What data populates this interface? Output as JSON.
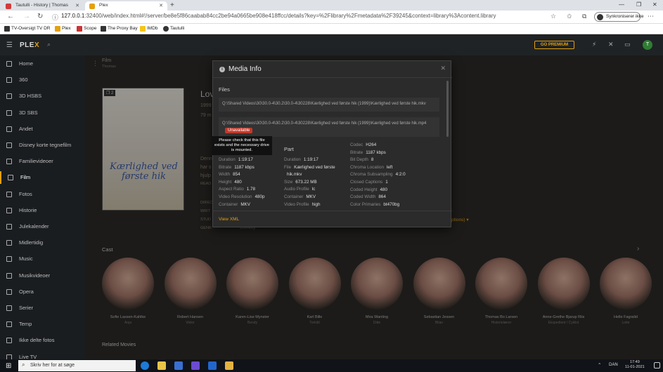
{
  "browser": {
    "tabs": [
      {
        "title": "Tautulli - History | Thomas"
      },
      {
        "title": "Plex"
      }
    ],
    "new_tab": "+",
    "url_host": "127.0.0.1",
    "url_path": ":32400/web/index.html#!/server/be8e5f86caabab84cc2be94a0665be908e418ffcc/details?key=%2Flibrary%2Fmetadata%2F39245&context=library%3Acontent.library",
    "sync_label": "Synkroniserer ikke",
    "bookmarks": [
      "TV-Oversigt TV DR",
      "Plex",
      "Scope",
      "The Proxy Bay",
      "IMDb",
      "Tautulli"
    ]
  },
  "plex": {
    "logo_main": "PLE",
    "logo_accent": "X",
    "go_premium": "GO PREMIUM",
    "user_initial": "T"
  },
  "sidebar": {
    "items": [
      {
        "label": "Home",
        "active": false
      },
      {
        "label": "360",
        "active": false
      },
      {
        "label": "3D HSBS",
        "active": false
      },
      {
        "label": "3D SBS",
        "active": false
      },
      {
        "label": "Andet",
        "active": false
      },
      {
        "label": "Disney korte tegnefilm",
        "active": false
      },
      {
        "label": "Familievideoer",
        "active": false
      },
      {
        "label": "Film",
        "active": true
      },
      {
        "label": "Fotos",
        "active": false
      },
      {
        "label": "Historie",
        "active": false
      },
      {
        "label": "Julekalender",
        "active": false
      },
      {
        "label": "Midlertidig",
        "active": false
      },
      {
        "label": "Music",
        "active": false
      },
      {
        "label": "Musikvideoer",
        "active": false
      },
      {
        "label": "Opera",
        "active": false
      },
      {
        "label": "Serier",
        "active": false
      },
      {
        "label": "Temp",
        "active": false
      },
      {
        "label": "Ikke delte fotos",
        "active": false
      },
      {
        "label": "Live TV",
        "active": false
      }
    ]
  },
  "main": {
    "breadcrumb": "Film",
    "breadcrumb_sub": "Thomas",
    "poster_badge": "2",
    "poster_title": "Kærlighed ved første hik",
    "bg_title": "Lov",
    "bg_year": "1999",
    "bg_duration": "79 m",
    "bg_line1": "Denn",
    "bg_line2": "har s",
    "bg_line3": "hjulp",
    "bg_read": "READ",
    "bg_dire": "DIREC",
    "bg_writ": "WRIT",
    "bg_stud": "STUD",
    "bg_genr": "GENR",
    "bg_comedy": "Comedy",
    "bg_captions": "ptions) ▾",
    "cast_heading": "Cast",
    "related_heading": "Related Movies",
    "cast": [
      {
        "name": "Sofie Lassen-Kahlke",
        "role": "Anja"
      },
      {
        "name": "Robert Hansen",
        "role": "Viktor"
      },
      {
        "name": "Karen-Lise Mynster",
        "role": "Bendy"
      },
      {
        "name": "Karl Bille",
        "role": "Torkild"
      },
      {
        "name": "Mira Wanting",
        "role": "Ditte"
      },
      {
        "name": "Sebastian Jessen",
        "role": "Bilan"
      },
      {
        "name": "Thomas Bo Larsen",
        "role": "Historielærer"
      },
      {
        "name": "Anne-Grethe Bjarup Riis",
        "role": "Ekspedient / Cyklist"
      },
      {
        "name": "Helle Fagralid",
        "role": "Lotte"
      }
    ]
  },
  "modal": {
    "title": "Media Info",
    "files_heading": "Files",
    "file1": "Q:\\Shared Videos\\30\\30.0-4\\30.2\\30.0-4\\30228\\Kærlighed ved første hik (1999)\\Kærlighed ved første hik.mkv",
    "file2": "Q:\\Shared Videos\\30\\30.0-4\\30.2\\30.0-4\\30228\\Kærlighed ved første hik (1999)\\Kærlighed ved første hik.mp4",
    "unavailable": "Unavailable",
    "tooltip": "Please check that this file exists and the necessary drive is mounted.",
    "media_col": [
      {
        "k": "Duration",
        "v": "1:19:17"
      },
      {
        "k": "Bitrate",
        "v": "1187 kbps"
      },
      {
        "k": "Width",
        "v": "854"
      },
      {
        "k": "Height",
        "v": "480"
      },
      {
        "k": "Aspect Ratio",
        "v": "1.78"
      },
      {
        "k": "Video Resolution",
        "v": "480p"
      },
      {
        "k": "Container",
        "v": "MKV"
      }
    ],
    "part_heading": "Part",
    "part_col": [
      {
        "k": "Duration",
        "v": "1:19:17"
      },
      {
        "k": "File",
        "v": "Kærlighed ved første"
      },
      {
        "k": "",
        "v": "hik.mkv"
      },
      {
        "k": "Size",
        "v": "673.22 MB"
      },
      {
        "k": "Audio Profile",
        "v": "lc"
      },
      {
        "k": "Container",
        "v": "MKV"
      },
      {
        "k": "Video Profile",
        "v": "high"
      }
    ],
    "video_col": [
      {
        "k": "Codec",
        "v": "H264"
      },
      {
        "k": "Bitrate",
        "v": "1187 kbps"
      },
      {
        "k": "Bit Depth",
        "v": "8"
      },
      {
        "k": "Chroma Location",
        "v": "left"
      },
      {
        "k": "Chroma Subsampling",
        "v": "4:2:0"
      },
      {
        "k": "Closed Captions",
        "v": "1"
      },
      {
        "k": "Coded Height",
        "v": "480"
      },
      {
        "k": "Coded Width",
        "v": "864"
      },
      {
        "k": "Color Primaries",
        "v": "bt470bg"
      }
    ],
    "view_xml": "View XML"
  },
  "taskbar": {
    "search_placeholder": "Skriv her for at søge",
    "lang": "DAN",
    "time": "17:49",
    "date": "11-01-2021"
  }
}
